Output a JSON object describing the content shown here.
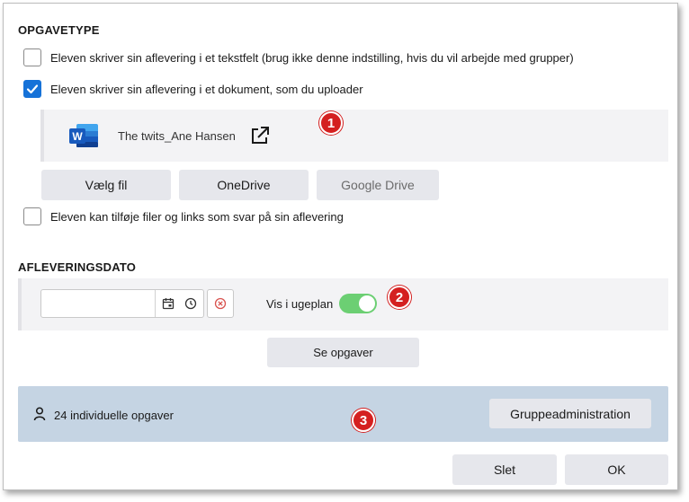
{
  "task_type": {
    "title": "OPGAVETYPE",
    "options": [
      {
        "label": "Eleven skriver sin aflevering i et tekstfelt (brug ikke denne indstilling, hvis du vil arbejde med grupper)",
        "checked": false
      },
      {
        "label": "Eleven skriver sin aflevering i et dokument, som du uploader",
        "checked": true
      }
    ],
    "file": {
      "icon": "word-icon",
      "icon_letter": "W",
      "name": "The twits_Ane Hansen"
    },
    "file_buttons": {
      "choose_file": "Vælg fil",
      "onedrive": "OneDrive",
      "google_drive": "Google Drive"
    },
    "attach_option": {
      "label": "Eleven kan tilføje filer og links som svar på sin aflevering",
      "checked": false
    }
  },
  "due_date": {
    "title": "AFLEVERINGSDATO",
    "date_value": "",
    "show_in_weekplan_label": "Vis i ugeplan",
    "show_in_weekplan": true,
    "see_tasks_button": "Se opgaver"
  },
  "groups": {
    "count_text": "24 individuelle opgaver",
    "admin_button": "Gruppeadministration"
  },
  "footer": {
    "delete_button": "Slet",
    "ok_button": "OK"
  },
  "markers": [
    "1",
    "2",
    "3"
  ],
  "colors": {
    "accent": "#1672d8",
    "toggle_on": "#6ccf73",
    "marker": "#d42020",
    "group_panel": "#c5d4e3",
    "word": "#2b579a"
  }
}
